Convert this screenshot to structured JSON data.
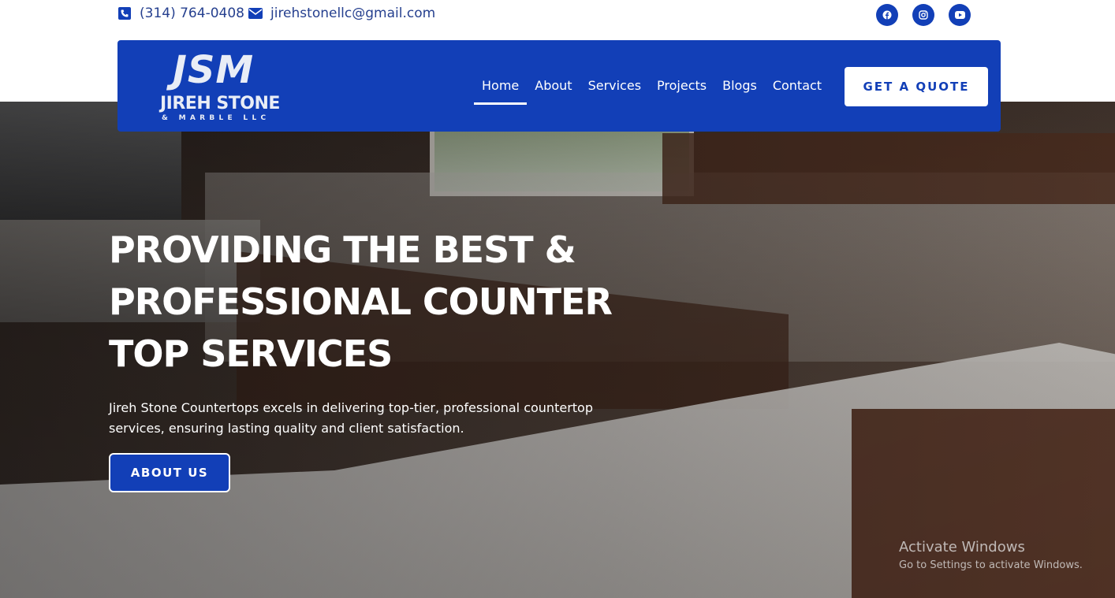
{
  "topbar": {
    "phone": "(314) 764-0408",
    "email": "jirehstonellc@gmail.com",
    "socials": [
      {
        "icon": "facebook-icon"
      },
      {
        "icon": "instagram-icon"
      },
      {
        "icon": "youtube-icon"
      }
    ]
  },
  "header": {
    "logo": {
      "mark": "JSM",
      "name": "JIREH STONE",
      "sub": "& MARBLE LLC"
    },
    "nav": [
      {
        "label": "Home",
        "active": true
      },
      {
        "label": "About"
      },
      {
        "label": "Services"
      },
      {
        "label": "Projects"
      },
      {
        "label": "Blogs"
      },
      {
        "label": "Contact"
      }
    ],
    "cta_label": "GET A QUOTE"
  },
  "hero": {
    "title_lines": [
      "PROVIDING THE BEST &",
      "PROFESSIONAL COUNTER",
      "TOP SERVICES"
    ],
    "description": "Jireh Stone Countertops excels in delivering top-tier, professional countertop services, ensuring lasting quality and client satisfaction.",
    "button_label": "ABOUT US"
  },
  "watermark": {
    "title": "Activate Windows",
    "subtitle": "Go to Settings to activate Windows."
  },
  "colors": {
    "brand_blue": "#123fb7",
    "contact_text": "#26408f",
    "white": "#ffffff"
  }
}
